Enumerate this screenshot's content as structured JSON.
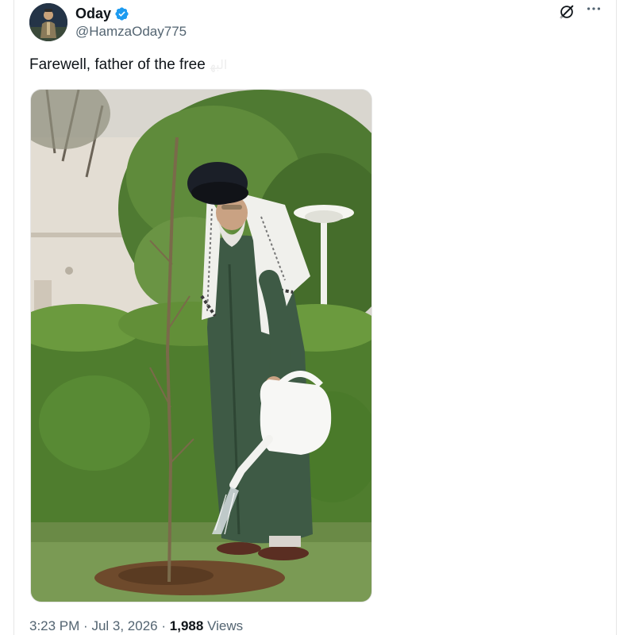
{
  "author": {
    "display_name": "Oday",
    "handle": "@HamzaOday775",
    "verified": true,
    "avatar_icon": "profile-photo"
  },
  "tweet": {
    "text": "Farewell, father of the free",
    "translate_hint": "ﺍﻟﺒﻬ"
  },
  "media": {
    "image_icon": "photo-man-watering-sapling"
  },
  "meta": {
    "time": "3:23 PM",
    "separator": "·",
    "date": "Jul 3, 2026",
    "views_count": "1,988",
    "views_label": "Views"
  },
  "icons": {
    "grok": "grok-icon",
    "more": "more-icon",
    "verified": "verified-badge-icon"
  },
  "colors": {
    "verified_blue": "#1d9bf0",
    "text_primary": "#0f1419",
    "text_secondary": "#536471"
  }
}
